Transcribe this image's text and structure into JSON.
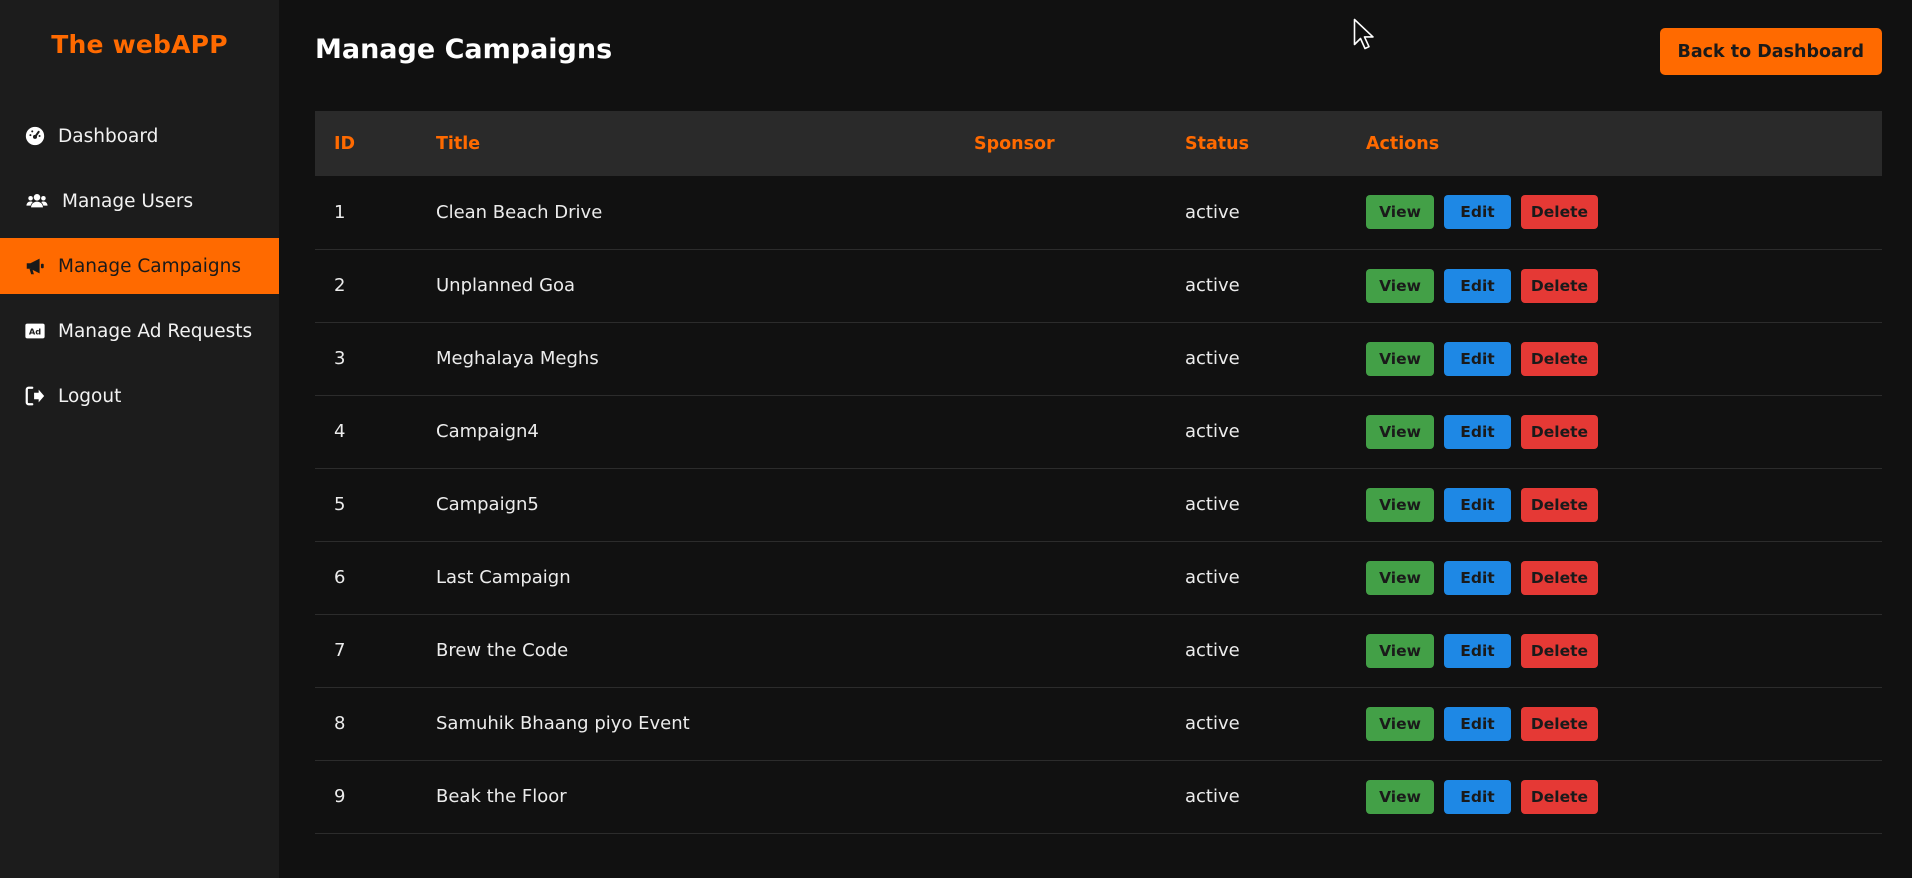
{
  "app": {
    "brand": "The webAPP"
  },
  "sidebar": {
    "items": [
      {
        "label": "Dashboard",
        "icon": "dashboard-gauge-icon",
        "active": false
      },
      {
        "label": "Manage Users",
        "icon": "users-icon",
        "active": false
      },
      {
        "label": "Manage Campaigns",
        "icon": "megaphone-icon",
        "active": true
      },
      {
        "label": "Manage Ad Requests",
        "icon": "ad-icon",
        "active": false
      },
      {
        "label": "Logout",
        "icon": "logout-icon",
        "active": false
      }
    ]
  },
  "header": {
    "title": "Manage Campaigns",
    "back_label": "Back to Dashboard"
  },
  "table": {
    "columns": [
      "ID",
      "Title",
      "Sponsor",
      "Status",
      "Actions"
    ],
    "actions": {
      "view": "View",
      "edit": "Edit",
      "delete": "Delete"
    },
    "rows": [
      {
        "id": "1",
        "title": "Clean Beach Drive",
        "sponsor": "",
        "status": "active"
      },
      {
        "id": "2",
        "title": "Unplanned Goa",
        "sponsor": "",
        "status": "active"
      },
      {
        "id": "3",
        "title": "Meghalaya Meghs",
        "sponsor": "",
        "status": "active"
      },
      {
        "id": "4",
        "title": "Campaign4",
        "sponsor": "",
        "status": "active"
      },
      {
        "id": "5",
        "title": "Campaign5",
        "sponsor": "",
        "status": "active"
      },
      {
        "id": "6",
        "title": "Last Campaign",
        "sponsor": "",
        "status": "active"
      },
      {
        "id": "7",
        "title": "Brew the Code",
        "sponsor": "",
        "status": "active"
      },
      {
        "id": "8",
        "title": "Samuhik Bhaang piyo Event",
        "sponsor": "",
        "status": "active"
      },
      {
        "id": "9",
        "title": "Beak the Floor",
        "sponsor": "",
        "status": "active"
      }
    ]
  },
  "colors": {
    "accent": "#ff6a00",
    "sidebar_bg": "#1c1c1c",
    "page_bg": "#111111",
    "header_row_bg": "#2a2a2a",
    "view": "#43a047",
    "edit": "#1e88e5",
    "delete": "#e53935"
  }
}
